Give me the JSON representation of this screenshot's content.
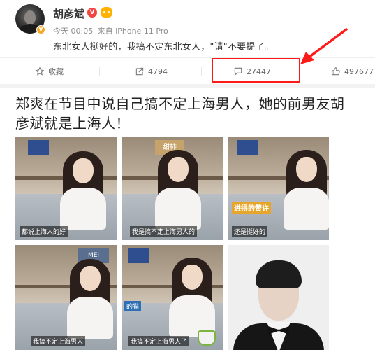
{
  "post": {
    "username": "胡彦斌",
    "vip_badge": "V",
    "avatar_badge": "V",
    "time": "今天 00:05",
    "source": "来自 iPhone 11 Pro",
    "text": "东北女人挺好的，我搞不定东北女人，\"请\"不要提了。"
  },
  "actions": {
    "favorite_label": "收藏",
    "share_count": "4794",
    "comment_count": "27447",
    "like_count": "497677"
  },
  "article": {
    "headline": "郑爽在节目中说自己搞不定上海男人，她的前男友胡彦斌就是上海人！"
  },
  "photos": [
    {
      "caption": "都说上海人的好"
    },
    {
      "caption": "我是搞不定上海男人的",
      "sign": "甜柿"
    },
    {
      "caption": "还是挺好的",
      "tag": "进得的赞许"
    },
    {
      "caption": "我搞不定上海男人",
      "sign": "MEI"
    },
    {
      "caption": "我搞不定上海男人了",
      "tag": "的猫"
    },
    {
      "caption": ""
    }
  ],
  "colors": {
    "highlight": "#ff1a1a",
    "vip": "#f4443f",
    "badge_orange": "#ffb300"
  }
}
